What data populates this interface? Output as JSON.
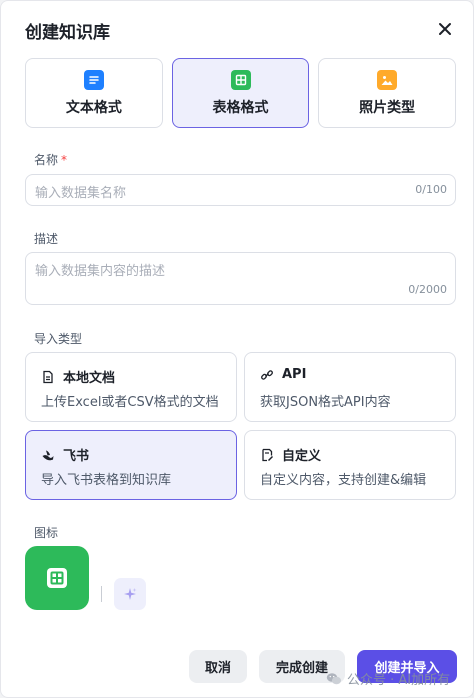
{
  "dialog": {
    "title": "创建知识库"
  },
  "formats": [
    {
      "label": "文本格式",
      "icon": "document-icon",
      "color": "#1e80ff",
      "active": false
    },
    {
      "label": "表格格式",
      "icon": "table-icon",
      "color": "#2dba5a",
      "active": true
    },
    {
      "label": "照片类型",
      "icon": "image-icon",
      "color": "#ffaa2b",
      "active": false
    }
  ],
  "name_field": {
    "label": "名称",
    "required_mark": "*",
    "placeholder": "输入数据集名称",
    "counter": "0/100"
  },
  "desc_field": {
    "label": "描述",
    "placeholder": "输入数据集内容的描述",
    "counter": "0/2000"
  },
  "import": {
    "label": "导入类型",
    "options": [
      {
        "title": "本地文档",
        "desc": "上传Excel或者CSV格式的文档",
        "icon": "file-icon",
        "active": false
      },
      {
        "title": "API",
        "desc": "获取JSON格式API内容",
        "icon": "link-icon",
        "active": false
      },
      {
        "title": "飞书",
        "desc": "导入飞书表格到知识库",
        "icon": "feishu-icon",
        "active": true
      },
      {
        "title": "自定义",
        "desc": "自定义内容，支持创建&编辑",
        "icon": "edit-icon",
        "active": false
      }
    ]
  },
  "icon_section": {
    "label": "图标",
    "avatar_icon": "table-icon",
    "avatar_color": "#2dba5a",
    "generate_icon": "sparkle-icon"
  },
  "footer": {
    "cancel": "取消",
    "finish": "完成创建",
    "create_import": "创建并导入"
  },
  "watermark": {
    "text": "公众号 · AI加所有",
    "icon": "wechat-icon"
  },
  "colors": {
    "accent": "#5b4fe6",
    "selected_border": "#6b63e3",
    "selected_bg": "#eeeffc",
    "required": "#f53f3f"
  }
}
